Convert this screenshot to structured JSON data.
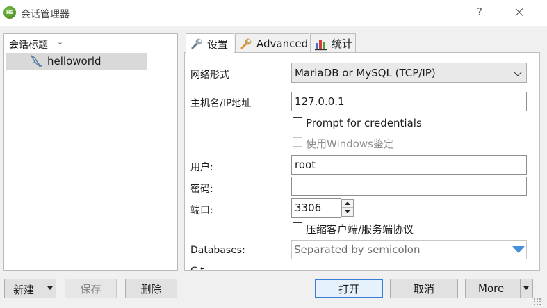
{
  "window": {
    "icon_text": "HS",
    "title": "会话管理器",
    "help_label": "?"
  },
  "tree": {
    "header": "会话标题",
    "sessions": [
      {
        "label": "helloworld",
        "icon": "dolphin-icon",
        "selected": true
      }
    ]
  },
  "tabs": [
    {
      "label": "设置",
      "icon": "wrench-icon",
      "active": true
    },
    {
      "label": "Advanced",
      "icon": "advanced-wrench-icon",
      "active": false
    },
    {
      "label": "统计",
      "icon": "bar-chart-icon",
      "active": false
    }
  ],
  "settings": {
    "network_type_label": "网络形式",
    "network_type_value": "MariaDB or MySQL (TCP/IP)",
    "host_label": "主机名/IP地址",
    "host_value": "127.0.0.1",
    "prompt_credentials_label": "Prompt for credentials",
    "prompt_credentials_checked": false,
    "windows_auth_label": "使用Windows鉴定",
    "windows_auth_checked": false,
    "user_label": "用户:",
    "user_value": "root",
    "password_label": "密码:",
    "password_value": "",
    "port_label": "端口:",
    "port_value": "3306",
    "compress_label": "压缩客户端/服务端协议",
    "compress_checked": false,
    "databases_label": "Databases:",
    "databases_placeholder": "Separated by semicolon",
    "next_label_partial": "C         t"
  },
  "buttons": {
    "new": "新建",
    "save": "保存",
    "delete": "删除",
    "open": "打开",
    "cancel": "取消",
    "more": "More"
  },
  "colors": {
    "accent": "#3b7cd6",
    "dropdown_triangle": "#4a8fd6",
    "selected_row": "#d9d9d9"
  }
}
